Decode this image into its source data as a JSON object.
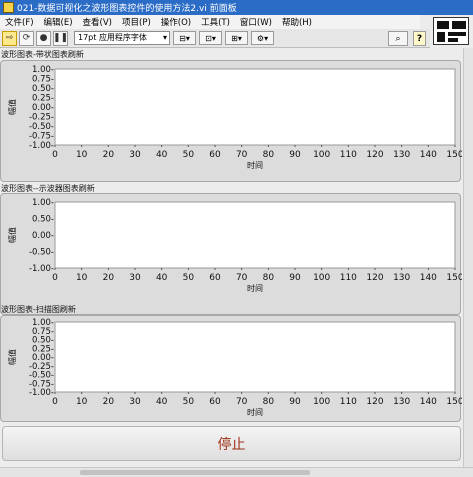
{
  "window": {
    "title": "021-数据可视化之波形图表控件的使用方法2.vi 前面板"
  },
  "menu": {
    "items": [
      "文件(F)",
      "编辑(E)",
      "查看(V)",
      "项目(P)",
      "操作(O)",
      "工具(T)",
      "窗口(W)",
      "帮助(H)"
    ]
  },
  "toolbar": {
    "font_select": "17pt 应用程序字体"
  },
  "charts": [
    {
      "label": "波形图表-带状图表刷新",
      "ylabel": "幅值",
      "xlabel": "时间",
      "yticks": [
        "1.00-",
        "0.75-",
        "0.50-",
        "0.25-",
        "0.00-",
        "-0.25-",
        "-0.50-",
        "-0.75-",
        "-1.00-"
      ],
      "xticks": [
        "0",
        "10",
        "20",
        "30",
        "40",
        "50",
        "60",
        "70",
        "80",
        "90",
        "100",
        "110",
        "120",
        "130",
        "140",
        "150"
      ]
    },
    {
      "label": "波形图表--示波器图表刷新",
      "ylabel": "幅值",
      "xlabel": "时间",
      "yticks": [
        "1.00-",
        "0.50-",
        "0.00-",
        "-0.50-",
        "-1.00-"
      ],
      "xticks": [
        "0",
        "10",
        "20",
        "30",
        "40",
        "50",
        "60",
        "70",
        "80",
        "90",
        "100",
        "110",
        "120",
        "130",
        "140",
        "150"
      ]
    },
    {
      "label": "波形图表-扫描图刷新",
      "ylabel": "幅值",
      "xlabel": "时间",
      "yticks": [
        "1.00-",
        "0.75-",
        "0.50-",
        "0.25-",
        "0.00-",
        "-0.25-",
        "-0.50-",
        "-0.75-",
        "-1.00-"
      ],
      "xticks": [
        "0",
        "10",
        "20",
        "30",
        "40",
        "50",
        "60",
        "70",
        "80",
        "90",
        "100",
        "110",
        "120",
        "130",
        "140",
        "150"
      ]
    }
  ],
  "chart_data": [
    {
      "type": "line",
      "title": "波形图表-带状图表刷新",
      "xlabel": "时间",
      "ylabel": "幅值",
      "xlim": [
        0,
        150
      ],
      "ylim": [
        -1,
        1
      ],
      "series": []
    },
    {
      "type": "line",
      "title": "波形图表--示波器图表刷新",
      "xlabel": "时间",
      "ylabel": "幅值",
      "xlim": [
        0,
        150
      ],
      "ylim": [
        -1,
        1
      ],
      "series": []
    },
    {
      "type": "line",
      "title": "波形图表-扫描图刷新",
      "xlabel": "时间",
      "ylabel": "幅值",
      "xlim": [
        0,
        150
      ],
      "ylim": [
        -1,
        1
      ],
      "series": []
    }
  ],
  "stop_button": {
    "label": "停止"
  }
}
